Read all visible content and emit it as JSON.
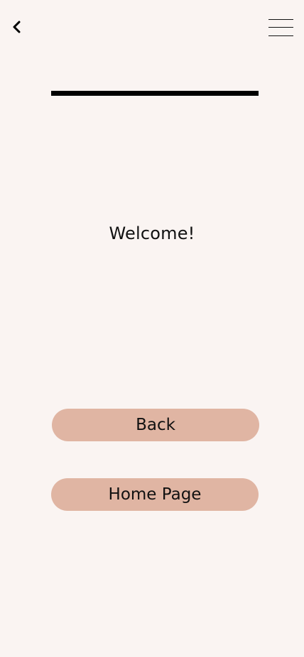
{
  "header": {
    "back_icon": "chevron-left-icon",
    "menu_icon": "hamburger-menu-icon"
  },
  "progress": {
    "value": 1.0
  },
  "main": {
    "welcome_text": "Welcome!"
  },
  "actions": {
    "back_label": "Back",
    "home_label": "Home Page"
  },
  "colors": {
    "background": "#faf4f2",
    "button": "#e0b5a3",
    "text": "#111111",
    "progress": "#000000"
  }
}
